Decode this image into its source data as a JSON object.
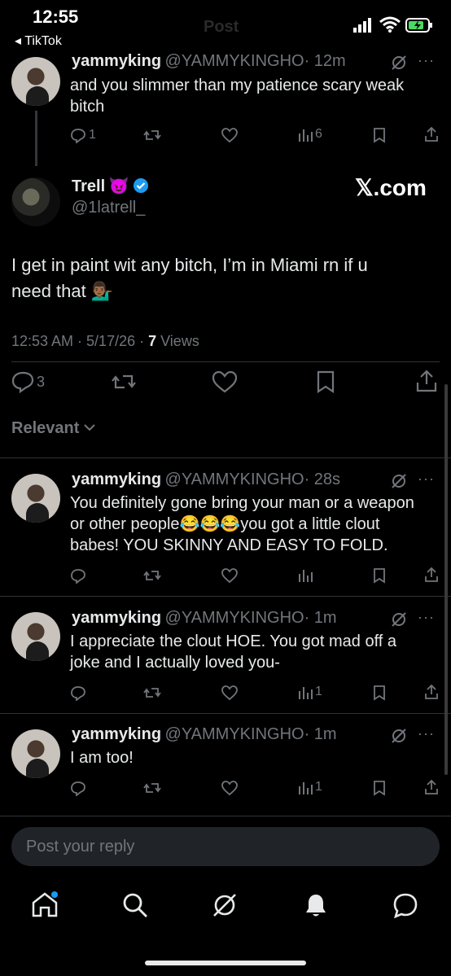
{
  "status": {
    "time": "12:55",
    "back_label": "◂ TikTok",
    "ghost_title": "Post"
  },
  "parent_tweet": {
    "name": "yammyking",
    "handle": "@YAMMYKINGHO",
    "time": "· 12m",
    "text_line1": "and you slimmer than my patience scary weak",
    "text_line2": "bitch",
    "replies": "1",
    "views": "6"
  },
  "main_tweet": {
    "name": "Trell",
    "emoji": "😈",
    "handle": "@1latrell_",
    "watermark": "𝕏.com",
    "text_line1": "I get in paint wit any bitch, I’m in Miami rn if u",
    "text_line2": "need that",
    "text_emoji": "💁🏾‍♂️",
    "meta_time": "12:53 AM · 5/17/26 · ",
    "views_count": "7",
    "views_label": " Views",
    "replies": "3"
  },
  "sort": {
    "label": "Relevant"
  },
  "replies": [
    {
      "name": "yammyking",
      "handle": "@YAMMYKINGHO",
      "time": "· 28s",
      "lines": [
        "You definitely gone bring your man or a weapon",
        "or other people😂😂😂you got a little clout",
        "babes! YOU SKINNY AND EASY TO FOLD."
      ],
      "views": ""
    },
    {
      "name": "yammyking",
      "handle": "@YAMMYKINGHO",
      "time": "· 1m",
      "lines": [
        "I appreciate the clout HOE. You got mad off a",
        "joke and I actually loved you-"
      ],
      "views": "1"
    },
    {
      "name": "yammyking",
      "handle": "@YAMMYKINGHO",
      "time": "· 1m",
      "lines": [
        "I am too!"
      ],
      "views": "1"
    }
  ],
  "composer": {
    "placeholder": "Post your reply"
  },
  "colors": {
    "background": "#000000",
    "text": "#e7e9ea",
    "muted": "#71767b",
    "divider": "#2f3336",
    "verified": "#1d9bf0",
    "composer_bg": "#202327"
  },
  "nav": [
    "home-icon",
    "search-icon",
    "grok-icon",
    "notifications-icon",
    "messages-icon"
  ]
}
